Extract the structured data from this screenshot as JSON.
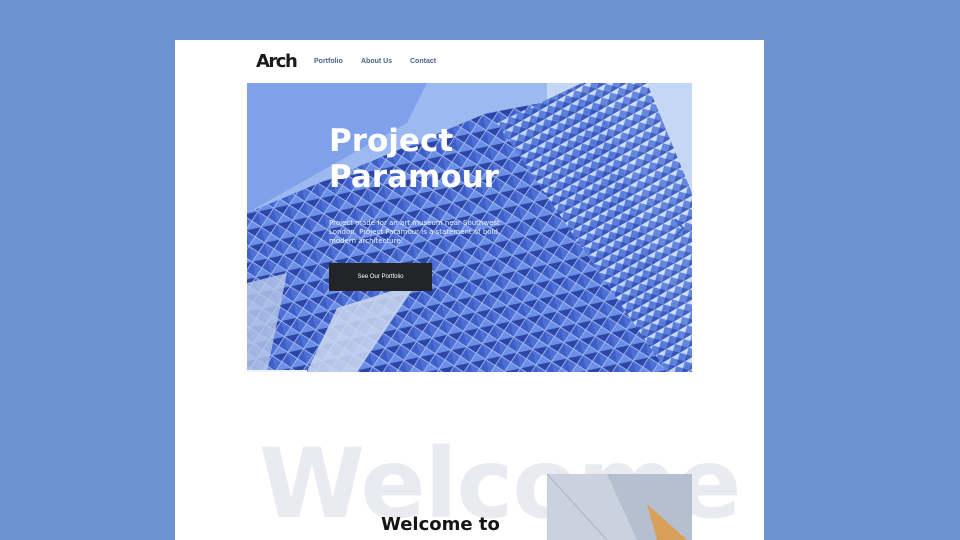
{
  "header": {
    "logo": "Arch",
    "nav": [
      {
        "label": "Portfolio"
      },
      {
        "label": "About Us"
      },
      {
        "label": "Contact"
      }
    ]
  },
  "hero": {
    "title": "Project Paramour",
    "description": "Project made for an art museum near Southwest London. Project Paramour is a statement of bold, modern architecture.",
    "cta_label": "See Our Portfolio",
    "next_icon": "chevron-right-icon"
  },
  "welcome": {
    "background_word": "Welcome",
    "heading": "Welcome to"
  },
  "colors": {
    "backdrop": "#6d93d1",
    "page": "#ffffff",
    "nav_text": "#4a6290",
    "button": "#222428",
    "facade_blue": "#3f5fc8"
  }
}
